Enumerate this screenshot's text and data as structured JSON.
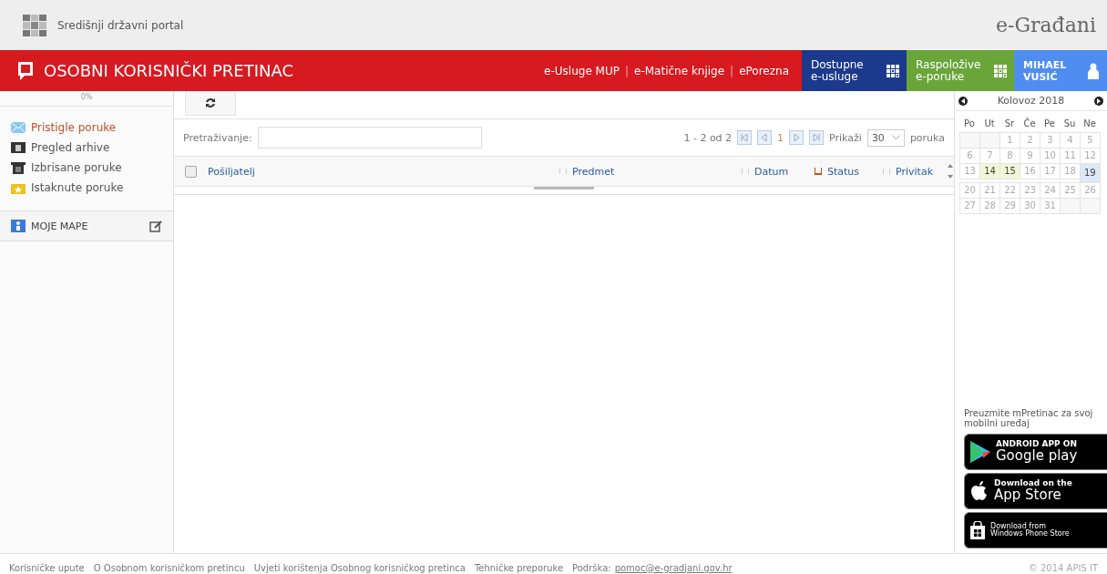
{
  "portal": {
    "name": "Središnji državni portal",
    "brand": "e-Građani"
  },
  "header": {
    "title": "OSOBNI KORISNIČKI PRETINAC",
    "links": [
      "e-Usluge MUP",
      "e-Matične knjige",
      "ePorezna"
    ],
    "separator": "|",
    "tiles": [
      {
        "kind": "services",
        "lines": [
          "Dostupne",
          "e-usluge"
        ]
      },
      {
        "kind": "messages",
        "lines": [
          "Raspoložive",
          "e-poruke"
        ]
      },
      {
        "kind": "user",
        "lines": [
          "MIHAEL",
          "VUSIĆ"
        ]
      }
    ]
  },
  "sidebar": {
    "progress": "0%",
    "items": [
      {
        "label": "Pristigle poruke",
        "kind": "inbox",
        "selected": true
      },
      {
        "label": "Pregled arhive",
        "kind": "archive",
        "selected": false
      },
      {
        "label": "Izbrisane poruke",
        "kind": "trash",
        "selected": false
      },
      {
        "label": "Istaknute poruke",
        "kind": "starred",
        "selected": false
      }
    ],
    "folders": "MOJE MAPE"
  },
  "toolbar": {
    "search_label": "Pretraživanje:",
    "range": "1 - 2 od 2",
    "page": "1",
    "show_label": "Prikaži",
    "page_size": "30",
    "per_label": "poruka"
  },
  "table": {
    "select_all": {
      "checked": false
    },
    "columns": [
      {
        "label": "Pošiljatelj",
        "sorted": false
      },
      {
        "label": "Predmet",
        "sorted": false
      },
      {
        "label": "Datum",
        "sorted": false
      },
      {
        "label": "Status",
        "sorted": true
      },
      {
        "label": "Privitak",
        "sorted": false
      }
    ]
  },
  "calendar": {
    "month": "Kolovoz 2018",
    "weekdays": [
      "Po",
      "Ut",
      "Sr",
      "Če",
      "Pe",
      "Su",
      "Ne"
    ],
    "weeks": [
      [
        {
          "kind": "empty"
        },
        {
          "kind": "empty"
        },
        {
          "kind": "day",
          "day": "1",
          "marked": false,
          "selected": false
        },
        {
          "kind": "day",
          "day": "2",
          "marked": false,
          "selected": false
        },
        {
          "kind": "day",
          "day": "3",
          "marked": false,
          "selected": false
        },
        {
          "kind": "day",
          "day": "4",
          "marked": false,
          "selected": false
        },
        {
          "kind": "day",
          "day": "5",
          "marked": false,
          "selected": false
        }
      ],
      [
        {
          "kind": "day",
          "day": "6",
          "marked": false,
          "selected": false
        },
        {
          "kind": "day",
          "day": "7",
          "marked": false,
          "selected": false
        },
        {
          "kind": "day",
          "day": "8",
          "marked": false,
          "selected": false
        },
        {
          "kind": "day",
          "day": "9",
          "marked": false,
          "selected": false
        },
        {
          "kind": "day",
          "day": "10",
          "marked": false,
          "selected": false
        },
        {
          "kind": "day",
          "day": "11",
          "marked": false,
          "selected": false
        },
        {
          "kind": "day",
          "day": "12",
          "marked": false,
          "selected": false
        }
      ],
      [
        {
          "kind": "day",
          "day": "13",
          "marked": false,
          "selected": false
        },
        {
          "kind": "day",
          "day": "14",
          "marked": true,
          "selected": false
        },
        {
          "kind": "day",
          "day": "15",
          "marked": true,
          "selected": false
        },
        {
          "kind": "day",
          "day": "16",
          "marked": false,
          "selected": false
        },
        {
          "kind": "day",
          "day": "17",
          "marked": false,
          "selected": false
        },
        {
          "kind": "day",
          "day": "18",
          "marked": false,
          "selected": false
        },
        {
          "kind": "day",
          "day": "19",
          "marked": false,
          "selected": true
        }
      ],
      [
        {
          "kind": "day",
          "day": "20",
          "marked": false,
          "selected": false
        },
        {
          "kind": "day",
          "day": "21",
          "marked": false,
          "selected": false
        },
        {
          "kind": "day",
          "day": "22",
          "marked": false,
          "selected": false
        },
        {
          "kind": "day",
          "day": "23",
          "marked": false,
          "selected": false
        },
        {
          "kind": "day",
          "day": "24",
          "marked": false,
          "selected": false
        },
        {
          "kind": "day",
          "day": "25",
          "marked": false,
          "selected": false
        },
        {
          "kind": "day",
          "day": "26",
          "marked": false,
          "selected": false
        }
      ],
      [
        {
          "kind": "day",
          "day": "27",
          "marked": false,
          "selected": false
        },
        {
          "kind": "day",
          "day": "28",
          "marked": false,
          "selected": false
        },
        {
          "kind": "day",
          "day": "29",
          "marked": false,
          "selected": false
        },
        {
          "kind": "day",
          "day": "30",
          "marked": false,
          "selected": false
        },
        {
          "kind": "day",
          "day": "31",
          "marked": false,
          "selected": false
        },
        {
          "kind": "empty"
        },
        {
          "kind": "empty"
        }
      ]
    ]
  },
  "apps": {
    "text": "Preuzmite mPretinac za svoj mobilni uređaj",
    "badges": [
      {
        "kind": "google",
        "small": "ANDROID APP ON",
        "big": "Google play"
      },
      {
        "kind": "apple",
        "small": "Download on the",
        "big": "App Store"
      },
      {
        "kind": "windows",
        "small": "Download from",
        "big": "Windows Phone Store"
      }
    ]
  },
  "footer": {
    "links": [
      "Korisničke upute",
      "O Osobnom korisničkom pretincu",
      "Uvjeti korištenja Osobnog korisničkog pretinca",
      "Tehničke preporuke"
    ],
    "support_label": "Podrška:",
    "email": "pomoc@e-gradjani.gov.hr",
    "copyright": "© 2014 APIS IT"
  }
}
